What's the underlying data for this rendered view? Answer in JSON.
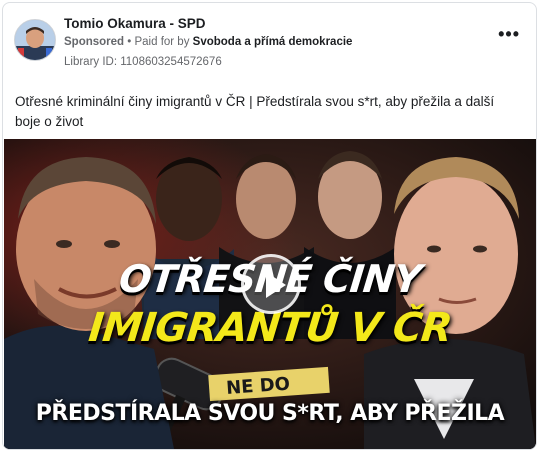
{
  "post": {
    "page_name": "Tomio Okamura - SPD",
    "sponsored_label": "Sponsored",
    "separator": " • ",
    "paid_for_prefix": "Paid for by ",
    "payer": "Svoboda a přímá demokracie",
    "library_id": "Library ID: 1108603254572676",
    "more_label": "•••",
    "caption": "Otřesné kriminální činy imigrantů v ČR | Předstírala svou s*rt, aby přežila a další boje o život"
  },
  "video": {
    "headline_line1": "OTŘESNÉ ČINY",
    "headline_line2": "IMIGRANTŮ V ČR",
    "subtitle": "PŘEDSTÍRALA SVOU S*RT, ABY PŘEŽILA",
    "background_text": "NE DO",
    "headline_color": "#f3e81a"
  }
}
